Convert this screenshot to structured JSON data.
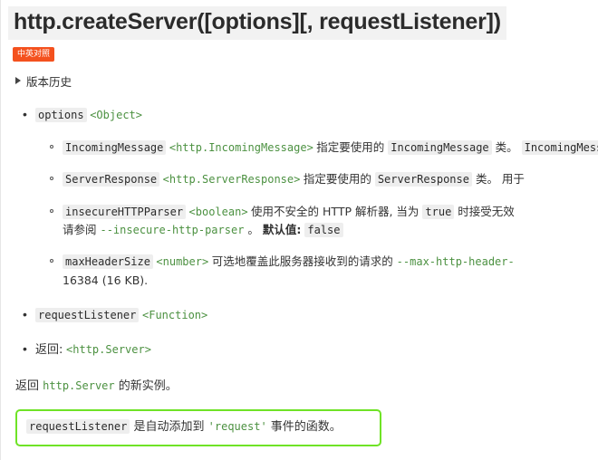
{
  "page": {
    "title": "http.createServer([options][, requestListener])",
    "accent_orange": "#f4511e",
    "accent_green_border": "#6fe326",
    "type_link_color": "#4c9141",
    "code_bg": "#eeeeee",
    "title_bg": "#f2f2f2"
  },
  "badge": {
    "label": "中英对照"
  },
  "version_history": {
    "label": "版本历史",
    "disclosure_icon": "triangle-right-icon",
    "expanded": false
  },
  "params": [
    {
      "name": "options",
      "type": "<Object>",
      "children": [
        {
          "name": "IncomingMessage",
          "type": "<http.IncomingMessage>",
          "desc_parts": [
            {
              "kind": "text",
              "value": "指定要使用的 "
            },
            {
              "kind": "code",
              "value": "IncomingMessage"
            },
            {
              "kind": "text",
              "value": " 类。 "
            },
            {
              "kind": "code",
              "value": "IncomingMessage"
            },
            {
              "kind": "text",
              "value": " 。"
            }
          ]
        },
        {
          "name": "ServerResponse",
          "type": "<http.ServerResponse>",
          "desc_parts": [
            {
              "kind": "text",
              "value": "指定要使用的 "
            },
            {
              "kind": "code",
              "value": "ServerResponse"
            },
            {
              "kind": "text",
              "value": " 类。 用于"
            }
          ]
        },
        {
          "name": "insecureHTTPParser",
          "type": "<boolean>",
          "desc_parts": [
            {
              "kind": "text",
              "value": "使用不安全的 HTTP 解析器, 当为 "
            },
            {
              "kind": "code",
              "value": "true"
            },
            {
              "kind": "text",
              "value": " 时接受无效"
            }
          ],
          "desc_parts_line2": [
            {
              "kind": "text",
              "value": "请参阅 "
            },
            {
              "kind": "type",
              "value": "--insecure-http-parser"
            },
            {
              "kind": "text",
              "value": " 。 "
            },
            {
              "kind": "strong",
              "value": "默认值:"
            },
            {
              "kind": "text",
              "value": " "
            },
            {
              "kind": "code",
              "value": "false"
            }
          ]
        },
        {
          "name": "maxHeaderSize",
          "type": "<number>",
          "desc_parts": [
            {
              "kind": "text",
              "value": "可选地覆盖此服务器接收到的请求的 "
            },
            {
              "kind": "type",
              "value": "--max-http-header-"
            }
          ],
          "desc_parts_line2": [
            {
              "kind": "text",
              "value": "16384 (16 KB)."
            }
          ]
        }
      ]
    },
    {
      "name": "requestListener",
      "type": "<Function>",
      "children": []
    }
  ],
  "returns": {
    "label": "返回:",
    "type": "<http.Server>"
  },
  "paragraph": {
    "parts": [
      {
        "kind": "text",
        "value": "返回 "
      },
      {
        "kind": "type",
        "value": "http.Server"
      },
      {
        "kind": "text",
        "value": " 的新实例。"
      }
    ]
  },
  "note": {
    "parts": [
      {
        "kind": "code",
        "value": "requestListener"
      },
      {
        "kind": "text",
        "value": " 是自动添加到 "
      },
      {
        "kind": "type",
        "value": "'request'"
      },
      {
        "kind": "text",
        "value": " 事件的函数。"
      }
    ]
  }
}
